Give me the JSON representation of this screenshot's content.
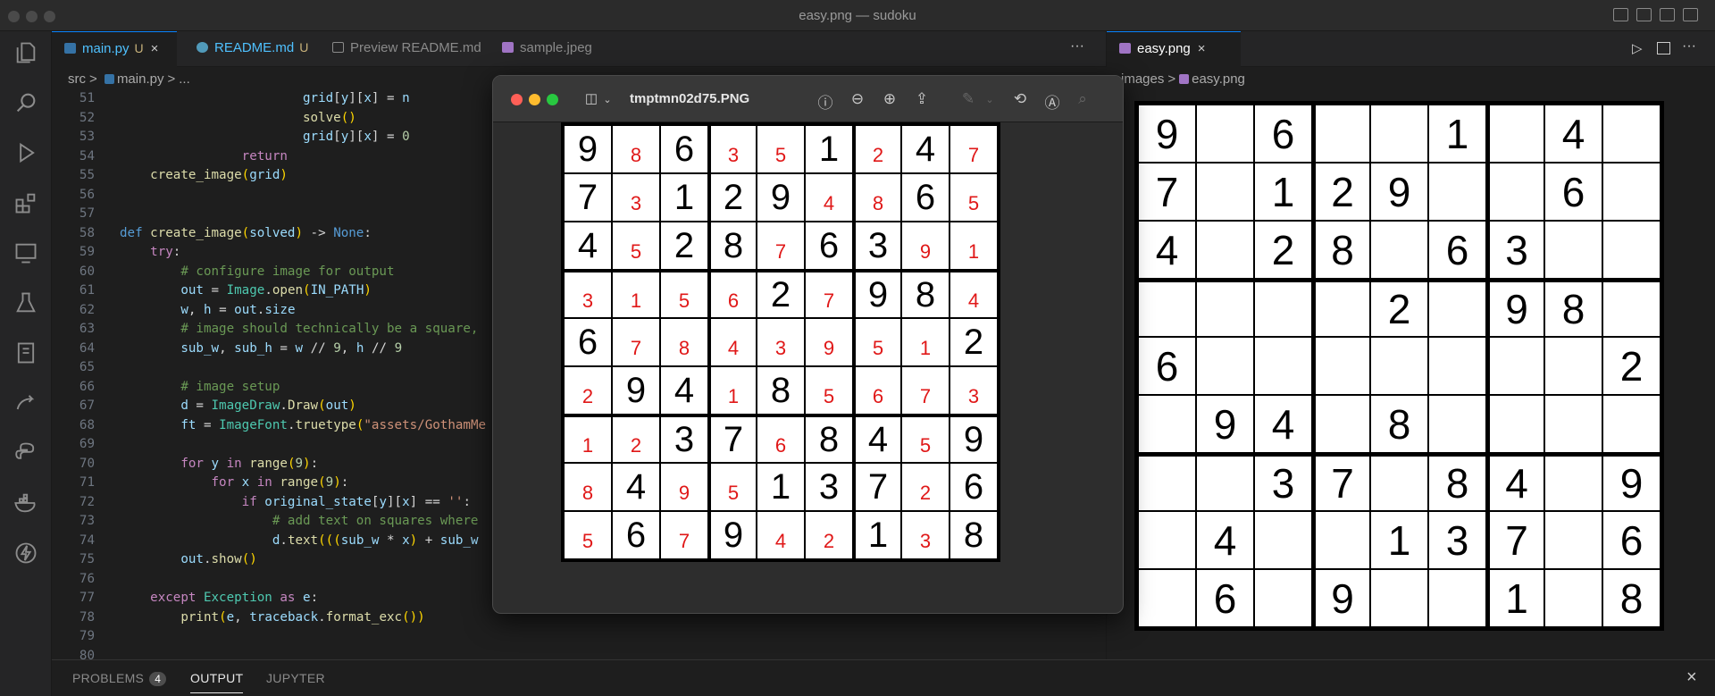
{
  "window": {
    "title": "easy.png — sudoku"
  },
  "editor": {
    "tabs": [
      {
        "label": "main.py",
        "badge": "U",
        "close": "×"
      },
      {
        "label": "README.md",
        "badge": "U"
      },
      {
        "label": "Preview README.md"
      },
      {
        "label": "sample.jpeg"
      }
    ],
    "more": "···",
    "breadcrumb": [
      "src",
      ">",
      "main.py",
      ">",
      "..."
    ],
    "lines": [
      {
        "n": "51",
        "indent": 6,
        "toks": [
          [
            "va",
            "grid"
          ],
          [
            "pl",
            "["
          ],
          [
            "va",
            "y"
          ],
          [
            "pl",
            "]["
          ],
          [
            "va",
            "x"
          ],
          [
            "pl",
            "] = "
          ],
          [
            "va",
            "n"
          ]
        ]
      },
      {
        "n": "52",
        "indent": 6,
        "toks": [
          [
            "fn",
            "solve"
          ],
          [
            "br",
            "()"
          ]
        ]
      },
      {
        "n": "53",
        "indent": 6,
        "toks": [
          [
            "va",
            "grid"
          ],
          [
            "pl",
            "["
          ],
          [
            "va",
            "y"
          ],
          [
            "pl",
            "]["
          ],
          [
            "va",
            "x"
          ],
          [
            "pl",
            "] = "
          ],
          [
            "nu",
            "0"
          ]
        ]
      },
      {
        "n": "54",
        "indent": 4,
        "toks": [
          [
            "kw",
            "return"
          ]
        ]
      },
      {
        "n": "55",
        "indent": 1,
        "toks": [
          [
            "fn",
            "create_image"
          ],
          [
            "br",
            "("
          ],
          [
            "va",
            "grid"
          ],
          [
            "br",
            ")"
          ]
        ]
      },
      {
        "n": "56",
        "indent": 0,
        "toks": []
      },
      {
        "n": "57",
        "indent": 0,
        "toks": []
      },
      {
        "n": "58",
        "indent": 0,
        "toks": [
          [
            "bi",
            "def "
          ],
          [
            "fn",
            "create_image"
          ],
          [
            "br",
            "("
          ],
          [
            "va",
            "solved"
          ],
          [
            "br",
            ")"
          ],
          [
            "pl",
            " -> "
          ],
          [
            "bi",
            "None"
          ],
          [
            "pl",
            ":"
          ]
        ]
      },
      {
        "n": "59",
        "indent": 1,
        "toks": [
          [
            "kw",
            "try"
          ],
          [
            "pl",
            ":"
          ]
        ]
      },
      {
        "n": "60",
        "indent": 2,
        "toks": [
          [
            "cm",
            "# configure image for output"
          ]
        ]
      },
      {
        "n": "61",
        "indent": 2,
        "toks": [
          [
            "va",
            "out"
          ],
          [
            "pl",
            " = "
          ],
          [
            "cl",
            "Image"
          ],
          [
            "pl",
            "."
          ],
          [
            "fn",
            "open"
          ],
          [
            "br",
            "("
          ],
          [
            "va",
            "IN_PATH"
          ],
          [
            "br",
            ")"
          ]
        ]
      },
      {
        "n": "62",
        "indent": 2,
        "toks": [
          [
            "va",
            "w"
          ],
          [
            "pl",
            ", "
          ],
          [
            "va",
            "h"
          ],
          [
            "pl",
            " = "
          ],
          [
            "va",
            "out"
          ],
          [
            "pl",
            "."
          ],
          [
            "va",
            "size"
          ]
        ]
      },
      {
        "n": "63",
        "indent": 2,
        "toks": [
          [
            "cm",
            "# image should technically be a square,"
          ]
        ]
      },
      {
        "n": "64",
        "indent": 2,
        "toks": [
          [
            "va",
            "sub_w"
          ],
          [
            "pl",
            ", "
          ],
          [
            "va",
            "sub_h"
          ],
          [
            "pl",
            " = "
          ],
          [
            "va",
            "w"
          ],
          [
            "pl",
            " // "
          ],
          [
            "nu",
            "9"
          ],
          [
            "pl",
            ", "
          ],
          [
            "va",
            "h"
          ],
          [
            "pl",
            " // "
          ],
          [
            "nu",
            "9"
          ]
        ]
      },
      {
        "n": "65",
        "indent": 0,
        "toks": []
      },
      {
        "n": "66",
        "indent": 2,
        "toks": [
          [
            "cm",
            "# image setup"
          ]
        ]
      },
      {
        "n": "67",
        "indent": 2,
        "toks": [
          [
            "va",
            "d"
          ],
          [
            "pl",
            " = "
          ],
          [
            "cl",
            "ImageDraw"
          ],
          [
            "pl",
            "."
          ],
          [
            "fn",
            "Draw"
          ],
          [
            "br",
            "("
          ],
          [
            "va",
            "out"
          ],
          [
            "br",
            ")"
          ]
        ]
      },
      {
        "n": "68",
        "indent": 2,
        "toks": [
          [
            "va",
            "ft"
          ],
          [
            "pl",
            " = "
          ],
          [
            "cl",
            "ImageFont"
          ],
          [
            "pl",
            "."
          ],
          [
            "fn",
            "truetype"
          ],
          [
            "br",
            "("
          ],
          [
            "st",
            "\"assets/GothamMe"
          ]
        ]
      },
      {
        "n": "69",
        "indent": 0,
        "toks": []
      },
      {
        "n": "70",
        "indent": 2,
        "toks": [
          [
            "kw",
            "for "
          ],
          [
            "va",
            "y"
          ],
          [
            "kw",
            " in "
          ],
          [
            "fn",
            "range"
          ],
          [
            "br",
            "("
          ],
          [
            "nu",
            "9"
          ],
          [
            "br",
            ")"
          ],
          [
            "pl",
            ":"
          ]
        ]
      },
      {
        "n": "71",
        "indent": 3,
        "toks": [
          [
            "kw",
            "for "
          ],
          [
            "va",
            "x"
          ],
          [
            "kw",
            " in "
          ],
          [
            "fn",
            "range"
          ],
          [
            "br",
            "("
          ],
          [
            "nu",
            "9"
          ],
          [
            "br",
            ")"
          ],
          [
            "pl",
            ":"
          ]
        ]
      },
      {
        "n": "72",
        "indent": 4,
        "toks": [
          [
            "kw",
            "if "
          ],
          [
            "va",
            "original_state"
          ],
          [
            "pl",
            "["
          ],
          [
            "va",
            "y"
          ],
          [
            "pl",
            "]["
          ],
          [
            "va",
            "x"
          ],
          [
            "pl",
            "] == "
          ],
          [
            "st",
            "''"
          ],
          [
            "pl",
            ":"
          ]
        ]
      },
      {
        "n": "73",
        "indent": 5,
        "toks": [
          [
            "cm",
            "# add text on squares where"
          ]
        ]
      },
      {
        "n": "74",
        "indent": 5,
        "toks": [
          [
            "va",
            "d"
          ],
          [
            "pl",
            "."
          ],
          [
            "fn",
            "text"
          ],
          [
            "br",
            "((("
          ],
          [
            "va",
            "sub_w"
          ],
          [
            "pl",
            " * "
          ],
          [
            "va",
            "x"
          ],
          [
            "br",
            ")"
          ],
          [
            "pl",
            " + "
          ],
          [
            "va",
            "sub_w"
          ]
        ]
      },
      {
        "n": "75",
        "indent": 2,
        "toks": [
          [
            "va",
            "out"
          ],
          [
            "pl",
            "."
          ],
          [
            "fn",
            "show"
          ],
          [
            "br",
            "()"
          ]
        ]
      },
      {
        "n": "76",
        "indent": 0,
        "toks": []
      },
      {
        "n": "77",
        "indent": 1,
        "toks": [
          [
            "kw",
            "except "
          ],
          [
            "cl",
            "Exception"
          ],
          [
            "kw",
            " as "
          ],
          [
            "va",
            "e"
          ],
          [
            "pl",
            ":"
          ]
        ]
      },
      {
        "n": "78",
        "indent": 2,
        "toks": [
          [
            "fn",
            "print"
          ],
          [
            "br",
            "("
          ],
          [
            "va",
            "e"
          ],
          [
            "pl",
            ", "
          ],
          [
            "va",
            "traceback"
          ],
          [
            "pl",
            "."
          ],
          [
            "fn",
            "format_exc"
          ],
          [
            "br",
            "())"
          ]
        ]
      },
      {
        "n": "79",
        "indent": 0,
        "toks": []
      },
      {
        "n": "80",
        "indent": 0,
        "toks": []
      }
    ]
  },
  "right_pane": {
    "tab": {
      "label": "easy.png",
      "close": "×"
    },
    "breadcrumb": [
      "images",
      ">",
      "easy.png"
    ]
  },
  "preview_window": {
    "title": "tmptmn02d75.PNG"
  },
  "easy_grid": [
    [
      "9",
      "",
      "6",
      "",
      "",
      "1",
      "",
      "4",
      ""
    ],
    [
      "7",
      "",
      "1",
      "2",
      "9",
      "",
      "",
      "6",
      ""
    ],
    [
      "4",
      "",
      "2",
      "8",
      "",
      "6",
      "3",
      "",
      ""
    ],
    [
      "",
      "",
      "",
      "",
      "2",
      "",
      "9",
      "8",
      ""
    ],
    [
      "6",
      "",
      "",
      "",
      "",
      "",
      "",
      "",
      "2"
    ],
    [
      "",
      "9",
      "4",
      "",
      "8",
      "",
      "",
      "",
      ""
    ],
    [
      "",
      "",
      "3",
      "7",
      "",
      "8",
      "4",
      "",
      "9"
    ],
    [
      "",
      "4",
      "",
      "",
      "1",
      "3",
      "7",
      "",
      "6"
    ],
    [
      "",
      "6",
      "",
      "9",
      "",
      "",
      "1",
      "",
      "8"
    ]
  ],
  "solved_grid": [
    [
      "9",
      "8",
      "6",
      "3",
      "5",
      "1",
      "2",
      "4",
      "7"
    ],
    [
      "7",
      "3",
      "1",
      "2",
      "9",
      "4",
      "8",
      "6",
      "5"
    ],
    [
      "4",
      "5",
      "2",
      "8",
      "7",
      "6",
      "3",
      "9",
      "1"
    ],
    [
      "3",
      "1",
      "5",
      "6",
      "2",
      "7",
      "9",
      "8",
      "4"
    ],
    [
      "6",
      "7",
      "8",
      "4",
      "3",
      "9",
      "5",
      "1",
      "2"
    ],
    [
      "2",
      "9",
      "4",
      "1",
      "8",
      "5",
      "6",
      "7",
      "3"
    ],
    [
      "1",
      "2",
      "3",
      "7",
      "6",
      "8",
      "4",
      "5",
      "9"
    ],
    [
      "8",
      "4",
      "9",
      "5",
      "1",
      "3",
      "7",
      "2",
      "6"
    ],
    [
      "5",
      "6",
      "7",
      "9",
      "4",
      "2",
      "1",
      "3",
      "8"
    ]
  ],
  "panel": {
    "tabs": [
      "PROBLEMS",
      "OUTPUT",
      "JUPYTER"
    ],
    "problems_count": "4",
    "close": "×"
  },
  "colors": {
    "accent": "#0a84ff",
    "solved_digit": "#e01818",
    "modified": "#c7b17a"
  }
}
